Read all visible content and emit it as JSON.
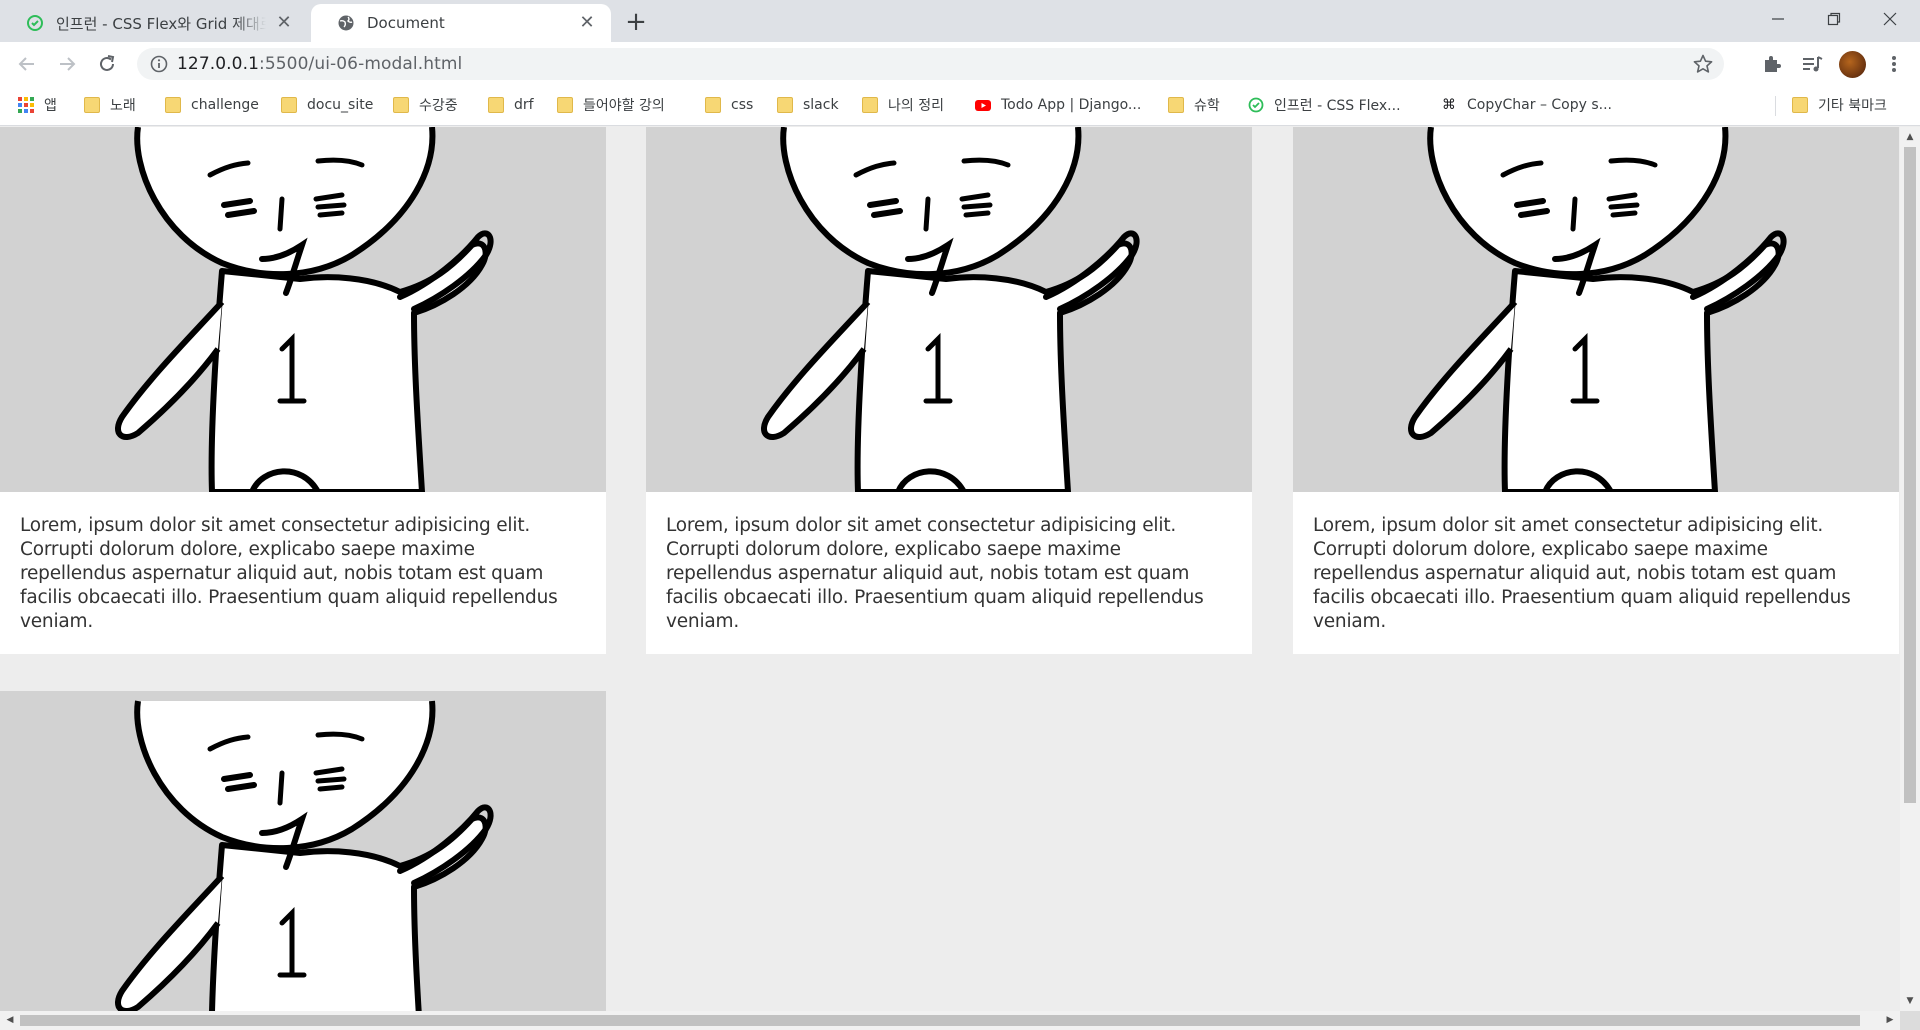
{
  "browser": {
    "tabs": [
      {
        "title": "인프런 - CSS Flex와 Grid 제대로 익히기",
        "active": false,
        "icon": "inflearn-icon"
      },
      {
        "title": "Document",
        "active": true,
        "icon": "globe-icon"
      }
    ],
    "new_tab_label": "+",
    "url_host": "127.0.0.1",
    "url_rest": ":5500/ui-06-modal.html"
  },
  "bookmarks": [
    {
      "label": "앱",
      "icon": "apps-grid-icon"
    },
    {
      "label": "노래",
      "icon": "folder-icon"
    },
    {
      "label": "challenge",
      "icon": "folder-icon"
    },
    {
      "label": "docu_site",
      "icon": "folder-icon"
    },
    {
      "label": "수강중",
      "icon": "folder-icon"
    },
    {
      "label": "drf",
      "icon": "folder-icon"
    },
    {
      "label": "들어야할 강의",
      "icon": "folder-icon"
    },
    {
      "label": "css",
      "icon": "folder-icon"
    },
    {
      "label": "slack",
      "icon": "folder-icon"
    },
    {
      "label": "나의 정리",
      "icon": "folder-icon"
    },
    {
      "label": "Todo App | Django...",
      "icon": "youtube-icon"
    },
    {
      "label": "슈학",
      "icon": "folder-icon"
    },
    {
      "label": "인프런 - CSS Flex...",
      "icon": "inflearn-icon"
    },
    {
      "label": "CopyChar – Copy s...",
      "icon": "command-icon"
    },
    {
      "label": "기타 북마크",
      "icon": "folder-icon"
    }
  ],
  "cards": [
    {
      "text": "Lorem, ipsum dolor sit amet consectetur adipisicing elit. Corrupti dolorum dolore, explicabo saepe maxime repellendus aspernatur aliquid aut, nobis totam est quam facilis obcaecati illo. Praesentium quam aliquid repellendus veniam.",
      "image": "cartoon-figure-number-1"
    },
    {
      "text": "Lorem, ipsum dolor sit amet consectetur adipisicing elit. Corrupti dolorum dolore, explicabo saepe maxime repellendus aspernatur aliquid aut, nobis totam est quam facilis obcaecati illo. Praesentium quam aliquid repellendus veniam.",
      "image": "cartoon-figure-number-1"
    },
    {
      "text": "Lorem, ipsum dolor sit amet consectetur adipisicing elit. Corrupti dolorum dolore, explicabo saepe maxime repellendus aspernatur aliquid aut, nobis totam est quam facilis obcaecati illo. Praesentium quam aliquid repellendus veniam.",
      "image": "cartoon-figure-number-1"
    },
    {
      "text": "",
      "image": "cartoon-figure-number-1"
    }
  ],
  "figure_number": "1",
  "colors": {
    "tabstrip": "#dee1e6",
    "page_bg": "#ededed",
    "thumb_bg": "#d2d2d2",
    "card_bg": "#ffffff",
    "text": "#333333"
  }
}
